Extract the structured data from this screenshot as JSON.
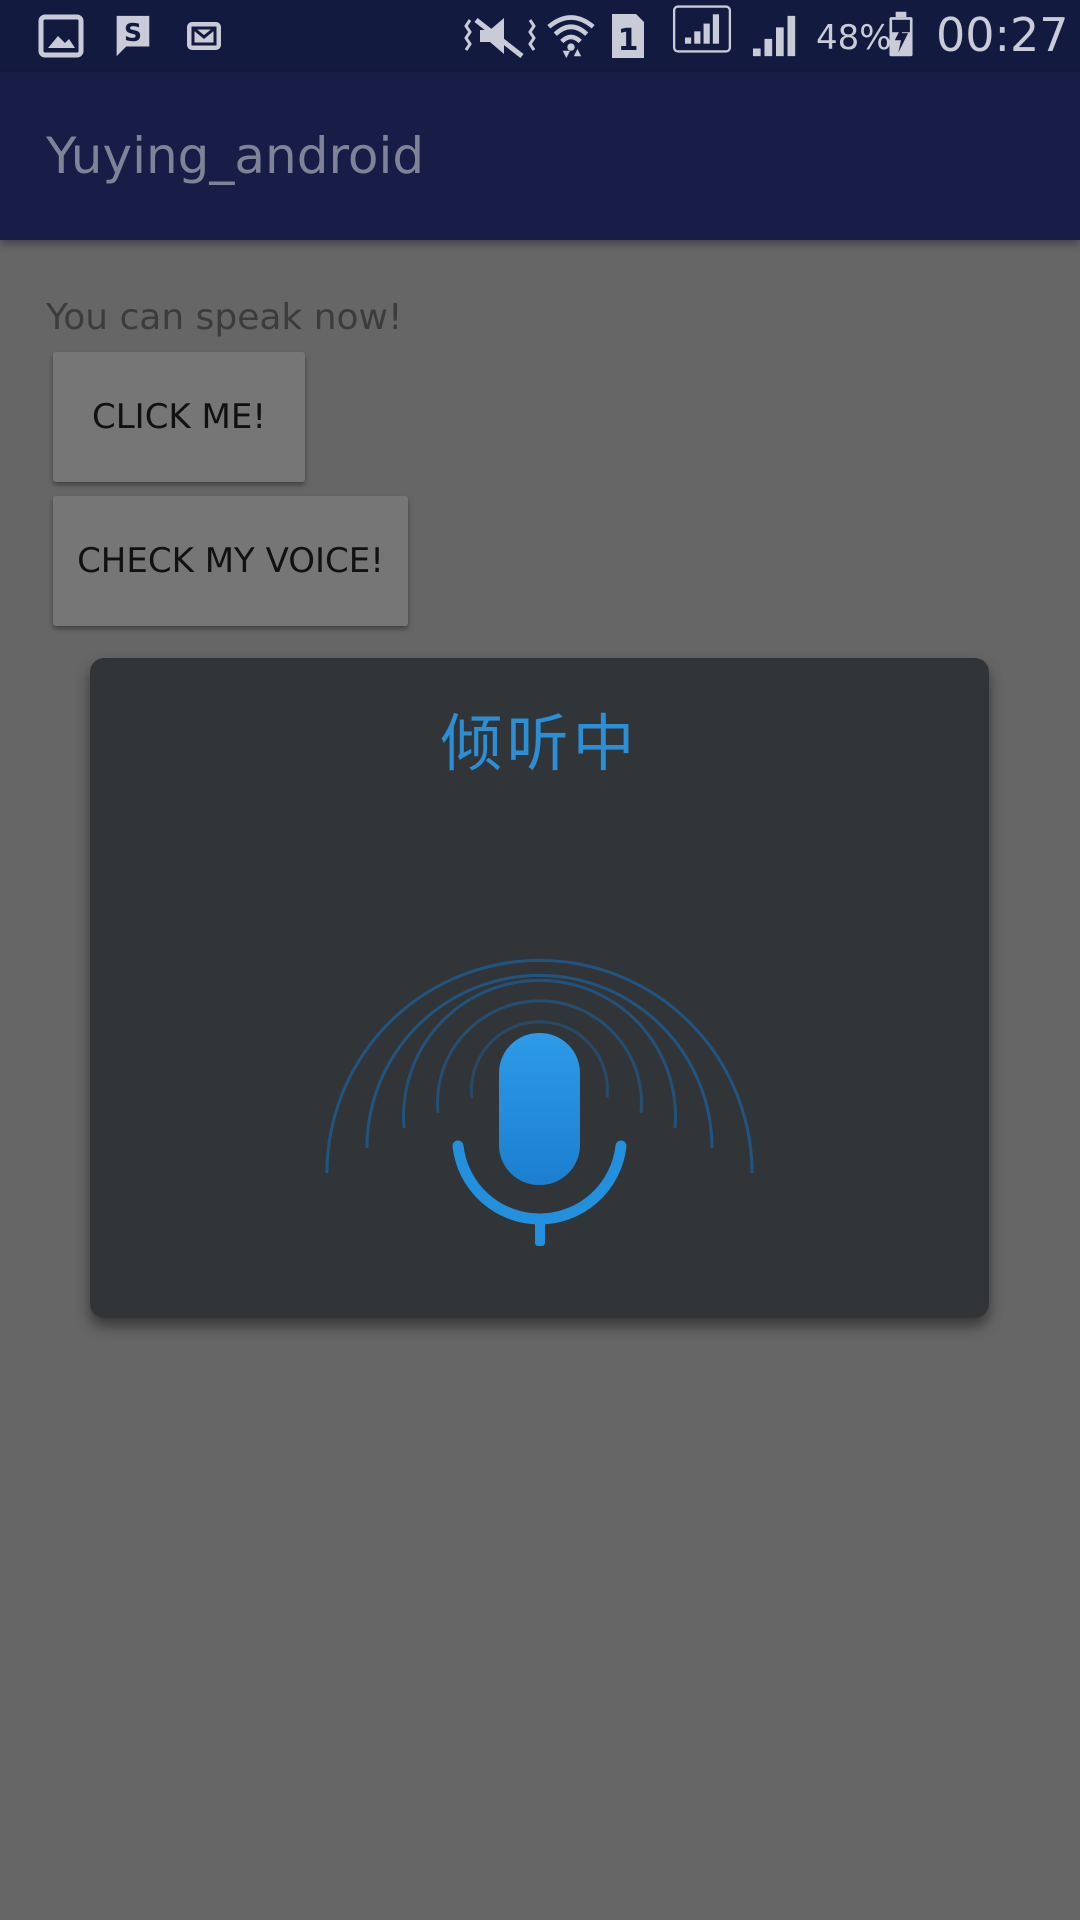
{
  "status_bar": {
    "notification_icons": [
      "gallery-icon",
      "s-app-icon",
      "email-icon"
    ],
    "system_icons": [
      "vibrate-mute-icon",
      "wifi-icon",
      "sim-1-icon",
      "signal-icon",
      "signal-icon",
      "battery-charging-icon"
    ],
    "battery_percent": "48%",
    "clock": "00:27"
  },
  "app_bar": {
    "title": "Yuying_android"
  },
  "main": {
    "hint_text": "You can speak now!",
    "click_button_label": "CLICK ME!",
    "check_voice_button_label": "CHECK MY VOICE!"
  },
  "voice_dialog": {
    "title": "倾听中",
    "icon": "microphone-icon",
    "accent_color": "#2a8fd6"
  },
  "colors": {
    "status_bar": "#121a40",
    "app_bar": "#171d47",
    "background": "#666666",
    "dialog": "#323538",
    "button": "#767676"
  }
}
